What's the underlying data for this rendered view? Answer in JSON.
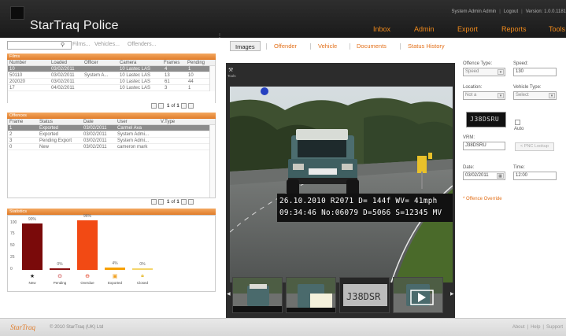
{
  "header": {
    "app_title": "StarTraq Police",
    "user_info": "System Admin Admin",
    "logout": "Logout",
    "version": "Version: 1.0.0.1181"
  },
  "nav": [
    "Inbox",
    "Admin",
    "Export",
    "Reports",
    "Tools"
  ],
  "search": {
    "placeholder": "",
    "filters": [
      "Films...",
      "Vehicles...",
      "Offenders..."
    ]
  },
  "films": {
    "title": "Films",
    "columns": [
      "Number",
      "Loaded",
      "Officer",
      "Camera",
      "Frames",
      "Pending"
    ],
    "rows": [
      [
        "10",
        "03/02/2011",
        "",
        "10 Lastec LAS",
        "4",
        "1"
      ],
      [
        "50110",
        "03/02/2011",
        "System A...",
        "10 Lastec LAS",
        "13",
        "10"
      ],
      [
        "202020",
        "03/02/2011",
        "",
        "10 Lastec LAS",
        "61",
        "44"
      ],
      [
        "17",
        "04/02/2011",
        "",
        "10 Lastec LAS",
        "3",
        "1"
      ]
    ],
    "selected_row": 0,
    "pager": {
      "page": "1",
      "of": "of",
      "total": "1"
    }
  },
  "offences": {
    "title": "Offences",
    "columns": [
      "Frame",
      "Status",
      "Date",
      "User",
      "V.Type"
    ],
    "rows": [
      [
        "1",
        "Exported",
        "03/02/2011",
        "Carmel Ava",
        ""
      ],
      [
        "2",
        "Exported",
        "03/02/2011",
        "System Admi...",
        ""
      ],
      [
        "3",
        "Pending Export",
        "03/02/2011",
        "System Admi...",
        ""
      ],
      [
        "0",
        "New",
        "03/02/2011",
        "cameron mark",
        ""
      ]
    ],
    "selected_row": 0,
    "pager": {
      "page": "1",
      "of": "of",
      "total": "1"
    }
  },
  "statistics": {
    "title": "Statistics",
    "y_ticks": [
      "100",
      "75",
      "50",
      "25",
      "0"
    ],
    "bars": [
      {
        "label": "New",
        "value": 90,
        "value_label": "90%",
        "color": "#7a0a0a",
        "icon": "star-icon",
        "glyph": "★",
        "icon_color": "#222"
      },
      {
        "label": "Pending",
        "value": 0,
        "value_label": "0%",
        "color": "#8a1010",
        "icon": "clock-icon",
        "glyph": "⊙",
        "icon_color": "#c02020"
      },
      {
        "label": "Overdue",
        "value": 96,
        "value_label": "96%",
        "color": "#f24a14",
        "icon": "minus-circle-icon",
        "glyph": "⊖",
        "icon_color": "#e03010"
      },
      {
        "label": "Exported",
        "value": 4,
        "value_label": "4%",
        "color": "#f7a000",
        "icon": "export-icon",
        "glyph": "▣",
        "icon_color": "#f0a020"
      },
      {
        "label": "Closed",
        "value": 0,
        "value_label": "0%",
        "color": "#f5d56a",
        "icon": "lock-icon",
        "glyph": "🔒︎",
        "icon_color": "#e8c040"
      }
    ]
  },
  "tabs": [
    {
      "label": "Images",
      "active": true
    },
    {
      "label": "Offender",
      "active": false
    },
    {
      "label": "Vehicle",
      "active": false
    },
    {
      "label": "Documents",
      "active": false
    },
    {
      "label": "Status History",
      "active": false
    }
  ],
  "viewer": {
    "tools_label": "Tools",
    "overlay_line1": "26.10.2010 R2071 D= 144f WV= 41mph",
    "overlay_line2": "09:34:46 No:06079 D=5066 S=12345 MV"
  },
  "form": {
    "offence_type_label": "Offence Type:",
    "offence_type_value": "Speed",
    "speed_label": "Speed:",
    "speed_value": "130",
    "location_label": "Location:",
    "location_value": "Not a",
    "vehicle_type_label": "Vehicle Type:",
    "vehicle_type_value": "Select",
    "plate_crop_text": "J38DSRU",
    "auto_label": "Auto",
    "vrm_label": "VRM:",
    "vrm_value": "J38DSRU",
    "pnc_button": "< PNC Lookup",
    "date_label": "Date:",
    "date_value": "03/02/2011",
    "time_label": "Time:",
    "time_value": "12:00",
    "override_link": "* Offence Override"
  },
  "footer": {
    "logo": "StarTraq",
    "copyright": "© 2010 StarTraq (UK) Ltd",
    "links": [
      "About",
      "Help",
      "Support"
    ]
  }
}
